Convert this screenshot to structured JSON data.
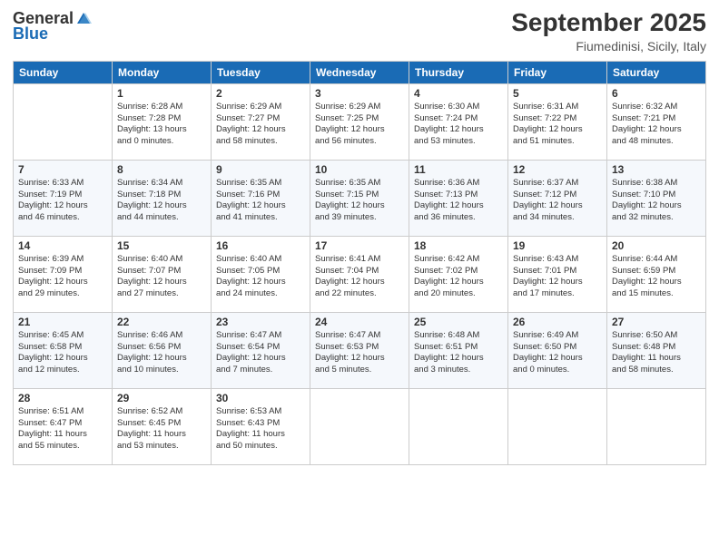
{
  "logo": {
    "general": "General",
    "blue": "Blue"
  },
  "title": "September 2025",
  "location": "Fiumedinisi, Sicily, Italy",
  "days_header": [
    "Sunday",
    "Monday",
    "Tuesday",
    "Wednesday",
    "Thursday",
    "Friday",
    "Saturday"
  ],
  "weeks": [
    [
      {
        "num": "",
        "info": ""
      },
      {
        "num": "1",
        "info": "Sunrise: 6:28 AM\nSunset: 7:28 PM\nDaylight: 13 hours\nand 0 minutes."
      },
      {
        "num": "2",
        "info": "Sunrise: 6:29 AM\nSunset: 7:27 PM\nDaylight: 12 hours\nand 58 minutes."
      },
      {
        "num": "3",
        "info": "Sunrise: 6:29 AM\nSunset: 7:25 PM\nDaylight: 12 hours\nand 56 minutes."
      },
      {
        "num": "4",
        "info": "Sunrise: 6:30 AM\nSunset: 7:24 PM\nDaylight: 12 hours\nand 53 minutes."
      },
      {
        "num": "5",
        "info": "Sunrise: 6:31 AM\nSunset: 7:22 PM\nDaylight: 12 hours\nand 51 minutes."
      },
      {
        "num": "6",
        "info": "Sunrise: 6:32 AM\nSunset: 7:21 PM\nDaylight: 12 hours\nand 48 minutes."
      }
    ],
    [
      {
        "num": "7",
        "info": "Sunrise: 6:33 AM\nSunset: 7:19 PM\nDaylight: 12 hours\nand 46 minutes."
      },
      {
        "num": "8",
        "info": "Sunrise: 6:34 AM\nSunset: 7:18 PM\nDaylight: 12 hours\nand 44 minutes."
      },
      {
        "num": "9",
        "info": "Sunrise: 6:35 AM\nSunset: 7:16 PM\nDaylight: 12 hours\nand 41 minutes."
      },
      {
        "num": "10",
        "info": "Sunrise: 6:35 AM\nSunset: 7:15 PM\nDaylight: 12 hours\nand 39 minutes."
      },
      {
        "num": "11",
        "info": "Sunrise: 6:36 AM\nSunset: 7:13 PM\nDaylight: 12 hours\nand 36 minutes."
      },
      {
        "num": "12",
        "info": "Sunrise: 6:37 AM\nSunset: 7:12 PM\nDaylight: 12 hours\nand 34 minutes."
      },
      {
        "num": "13",
        "info": "Sunrise: 6:38 AM\nSunset: 7:10 PM\nDaylight: 12 hours\nand 32 minutes."
      }
    ],
    [
      {
        "num": "14",
        "info": "Sunrise: 6:39 AM\nSunset: 7:09 PM\nDaylight: 12 hours\nand 29 minutes."
      },
      {
        "num": "15",
        "info": "Sunrise: 6:40 AM\nSunset: 7:07 PM\nDaylight: 12 hours\nand 27 minutes."
      },
      {
        "num": "16",
        "info": "Sunrise: 6:40 AM\nSunset: 7:05 PM\nDaylight: 12 hours\nand 24 minutes."
      },
      {
        "num": "17",
        "info": "Sunrise: 6:41 AM\nSunset: 7:04 PM\nDaylight: 12 hours\nand 22 minutes."
      },
      {
        "num": "18",
        "info": "Sunrise: 6:42 AM\nSunset: 7:02 PM\nDaylight: 12 hours\nand 20 minutes."
      },
      {
        "num": "19",
        "info": "Sunrise: 6:43 AM\nSunset: 7:01 PM\nDaylight: 12 hours\nand 17 minutes."
      },
      {
        "num": "20",
        "info": "Sunrise: 6:44 AM\nSunset: 6:59 PM\nDaylight: 12 hours\nand 15 minutes."
      }
    ],
    [
      {
        "num": "21",
        "info": "Sunrise: 6:45 AM\nSunset: 6:58 PM\nDaylight: 12 hours\nand 12 minutes."
      },
      {
        "num": "22",
        "info": "Sunrise: 6:46 AM\nSunset: 6:56 PM\nDaylight: 12 hours\nand 10 minutes."
      },
      {
        "num": "23",
        "info": "Sunrise: 6:47 AM\nSunset: 6:54 PM\nDaylight: 12 hours\nand 7 minutes."
      },
      {
        "num": "24",
        "info": "Sunrise: 6:47 AM\nSunset: 6:53 PM\nDaylight: 12 hours\nand 5 minutes."
      },
      {
        "num": "25",
        "info": "Sunrise: 6:48 AM\nSunset: 6:51 PM\nDaylight: 12 hours\nand 3 minutes."
      },
      {
        "num": "26",
        "info": "Sunrise: 6:49 AM\nSunset: 6:50 PM\nDaylight: 12 hours\nand 0 minutes."
      },
      {
        "num": "27",
        "info": "Sunrise: 6:50 AM\nSunset: 6:48 PM\nDaylight: 11 hours\nand 58 minutes."
      }
    ],
    [
      {
        "num": "28",
        "info": "Sunrise: 6:51 AM\nSunset: 6:47 PM\nDaylight: 11 hours\nand 55 minutes."
      },
      {
        "num": "29",
        "info": "Sunrise: 6:52 AM\nSunset: 6:45 PM\nDaylight: 11 hours\nand 53 minutes."
      },
      {
        "num": "30",
        "info": "Sunrise: 6:53 AM\nSunset: 6:43 PM\nDaylight: 11 hours\nand 50 minutes."
      },
      {
        "num": "",
        "info": ""
      },
      {
        "num": "",
        "info": ""
      },
      {
        "num": "",
        "info": ""
      },
      {
        "num": "",
        "info": ""
      }
    ]
  ]
}
